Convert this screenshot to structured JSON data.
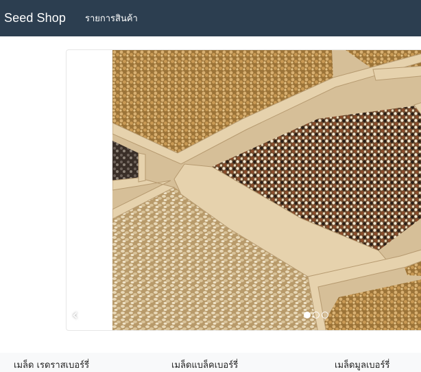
{
  "navbar": {
    "brand": "Seed Shop",
    "link_products": "รายการสินค้า",
    "bg_color": "#2c3e50"
  },
  "carousel": {
    "prev_icon": "‹",
    "slide_count": 3,
    "active_index": 0
  },
  "categories": [
    "เมล็ด เรดราสเบอร์รี่",
    "เมล็ดแบล็คเบอร์รี่",
    "เมล็ดมูลเบอร์รี่"
  ]
}
